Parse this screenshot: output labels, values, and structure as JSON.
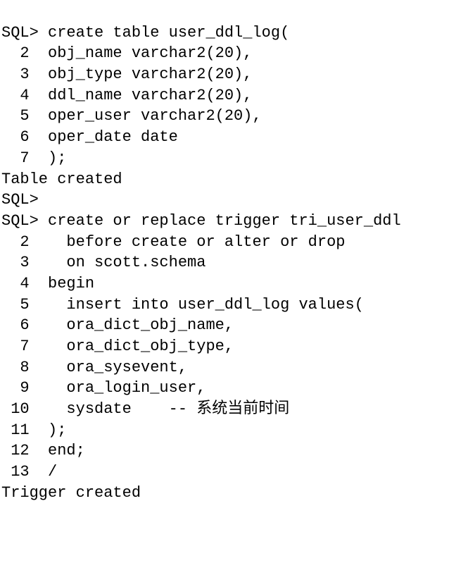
{
  "prompt": "SQL>",
  "blocks": [
    {
      "type": "sql",
      "firstLine": "create table user_ddl_log(",
      "continuations": [
        "obj_name varchar2(20),",
        "obj_type varchar2(20),",
        "ddl_name varchar2(20),",
        "oper_user varchar2(20),",
        "oper_date date",
        ");"
      ],
      "result": "Table created"
    },
    {
      "type": "blank"
    },
    {
      "type": "prompt_only"
    },
    {
      "type": "sql",
      "firstLine": "create or replace trigger tri_user_ddl",
      "continuations": [
        "  before create or alter or drop",
        "  on scott.schema",
        "begin",
        "  insert into user_ddl_log values(",
        "  ora_dict_obj_name,",
        "  ora_dict_obj_type,",
        "  ora_sysevent,",
        "  ora_login_user,",
        "  sysdate    -- 系统当前时间",
        ");",
        "end;",
        "/"
      ],
      "result": "Trigger created"
    }
  ]
}
